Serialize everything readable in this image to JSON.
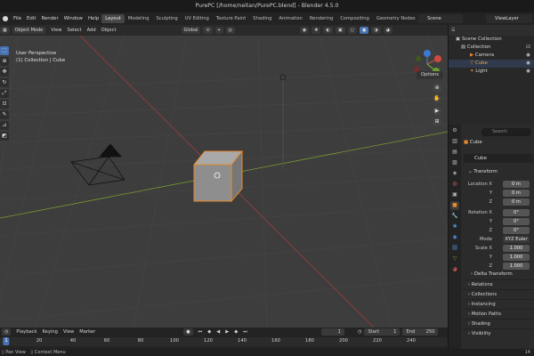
{
  "window": {
    "title": "PurePC [/home/neitan/PurePC.blend] - Blender 4.5.0"
  },
  "menu": {
    "items": [
      "File",
      "Edit",
      "Render",
      "Window",
      "Help"
    ]
  },
  "workspaces": {
    "tabs": [
      "Layout",
      "Modeling",
      "Sculpting",
      "UV Editing",
      "Texture Paint",
      "Shading",
      "Animation",
      "Rendering",
      "Compositing",
      "Geometry Nodes",
      "Sc"
    ],
    "active": "Layout"
  },
  "scene": {
    "name": "Scene",
    "view_layer": "ViewLayer"
  },
  "header3d": {
    "mode": "Object Mode",
    "view": "View",
    "select": "Select",
    "add": "Add",
    "object": "Object",
    "orientation": "Global"
  },
  "viewport": {
    "perspective": "User Perspective",
    "collection_info": "(1) Collection | Cube",
    "options_label": "Options"
  },
  "outliner": {
    "items": [
      {
        "label": "Scene Collection",
        "icon": "scene-collection-icon"
      },
      {
        "label": "Collection",
        "icon": "collection-icon"
      },
      {
        "label": "Camera",
        "icon": "camera-icon"
      },
      {
        "label": "Cube",
        "icon": "cube-icon"
      },
      {
        "label": "Light",
        "icon": "light-icon"
      }
    ]
  },
  "properties": {
    "search_placeholder": "Search",
    "object_name": "Cube",
    "mesh_name": "Cube",
    "transform_label": "Transform",
    "location_label": "Location X",
    "rotation_label": "Rotation X",
    "scale_label": "Scale X",
    "axis_y": "Y",
    "axis_z": "Z",
    "location": [
      "0 m",
      "0 m",
      "0 m"
    ],
    "rotation": [
      "0°",
      "0°",
      "0°"
    ],
    "mode_label": "Mode",
    "mode_value": "XYZ Euler",
    "scale": [
      "1.000",
      "1.000",
      "1.000"
    ],
    "delta_transform": "Delta Transform",
    "sections": [
      "Relations",
      "Collections",
      "Instancing",
      "Motion Paths",
      "Shading",
      "Visibility"
    ]
  },
  "timeline": {
    "menu": [
      "Playback",
      "Keying",
      "View",
      "Marker"
    ],
    "current_frame": "1",
    "start_label": "Start",
    "start_value": "1",
    "end_label": "End",
    "end_value": "250",
    "ruler_ticks": [
      "1",
      "20",
      "40",
      "60",
      "80",
      "100",
      "120",
      "140",
      "160",
      "180",
      "200",
      "220",
      "240"
    ]
  },
  "statusbar": {
    "left": "Pan View",
    "middle": "Context Menu",
    "right": "14"
  }
}
